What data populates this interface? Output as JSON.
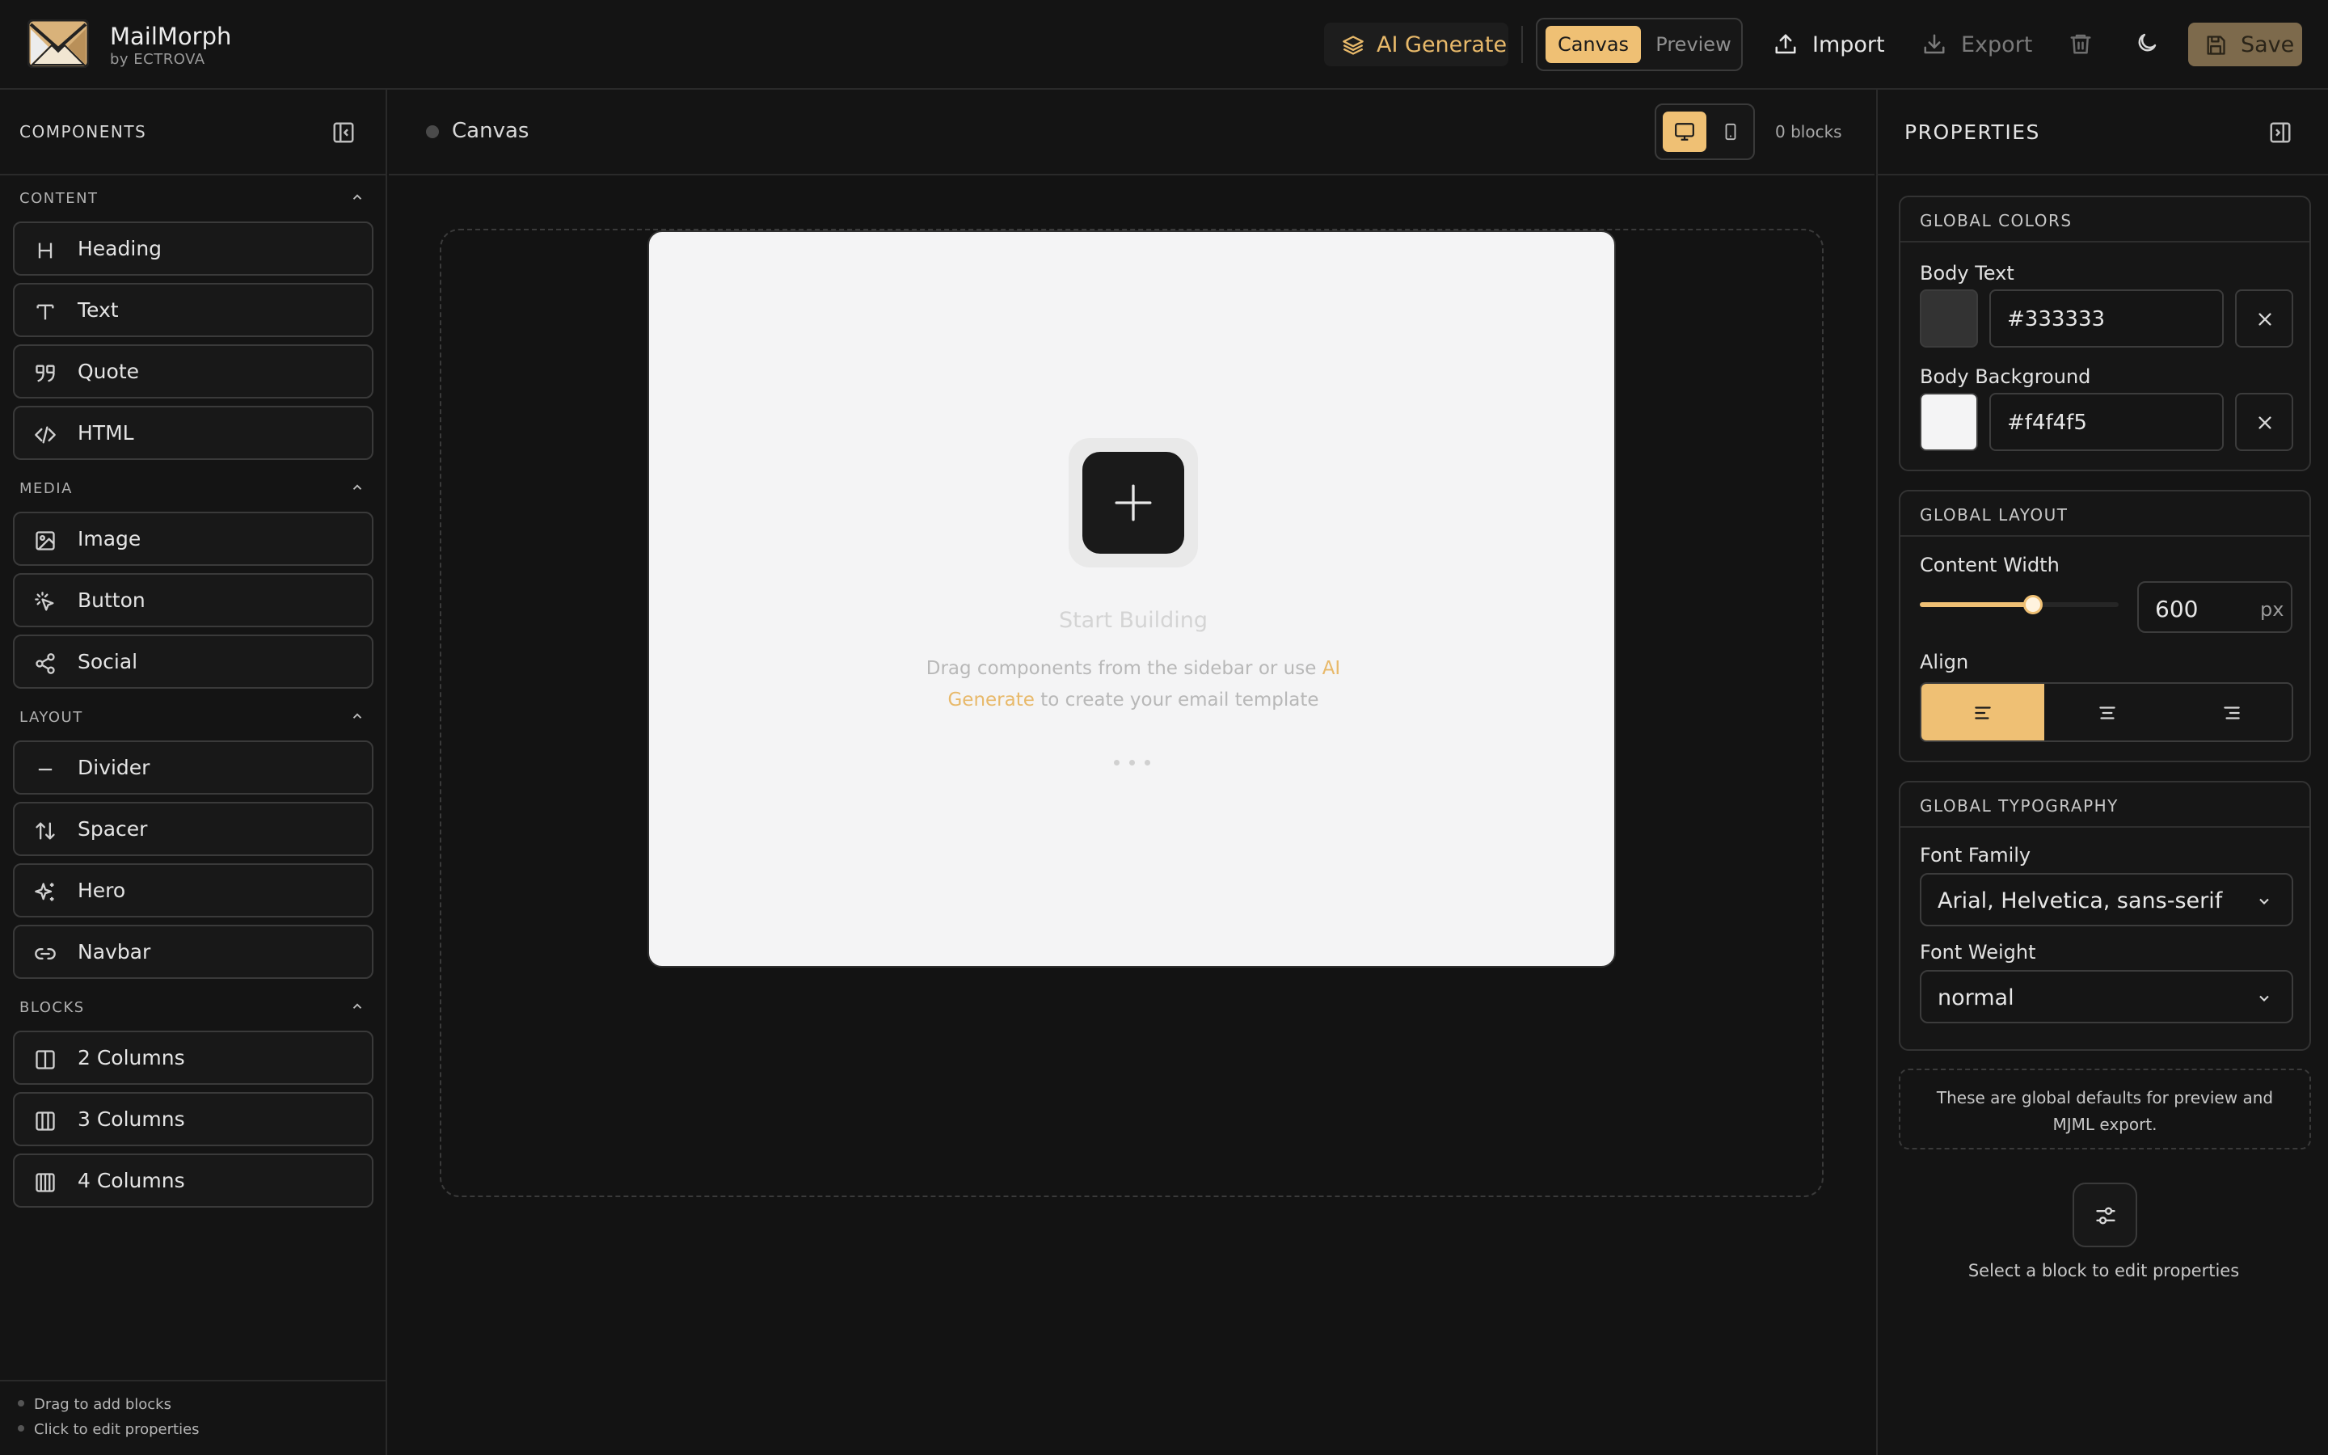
{
  "app": {
    "name": "MailMorph",
    "by_line": "by ECTROVA"
  },
  "toolbar": {
    "ai_generate": "AI Generate",
    "view_tabs": [
      "Canvas",
      "Preview"
    ],
    "active_view": "Canvas",
    "import": "Import",
    "export": "Export",
    "save": "Save"
  },
  "sidebar": {
    "title": "COMPONENTS",
    "sections": [
      {
        "label": "CONTENT",
        "items": [
          {
            "label": "Heading",
            "icon": "heading-icon"
          },
          {
            "label": "Text",
            "icon": "text-icon"
          },
          {
            "label": "Quote",
            "icon": "quote-icon"
          },
          {
            "label": "HTML",
            "icon": "code-icon"
          }
        ]
      },
      {
        "label": "MEDIA",
        "items": [
          {
            "label": "Image",
            "icon": "image-icon"
          },
          {
            "label": "Button",
            "icon": "pointer-click-icon"
          },
          {
            "label": "Social",
            "icon": "share-icon"
          }
        ]
      },
      {
        "label": "LAYOUT",
        "items": [
          {
            "label": "Divider",
            "icon": "minus-icon"
          },
          {
            "label": "Spacer",
            "icon": "arrows-updown-icon"
          },
          {
            "label": "Hero",
            "icon": "sparkles-icon"
          },
          {
            "label": "Navbar",
            "icon": "link-icon"
          }
        ]
      },
      {
        "label": "BLOCKS",
        "items": [
          {
            "label": "2 Columns",
            "icon": "columns-2-icon"
          },
          {
            "label": "3 Columns",
            "icon": "columns-3-icon"
          },
          {
            "label": "4 Columns",
            "icon": "columns-4-icon"
          }
        ]
      }
    ],
    "hints": [
      "Drag to add blocks",
      "Click to edit properties"
    ]
  },
  "canvas": {
    "title": "Canvas",
    "blocks_count": "0 blocks",
    "device": "desktop",
    "empty_title": "Start Building",
    "empty_text_before": "Drag components from the sidebar or use ",
    "empty_text_link": "AI Generate",
    "empty_text_after": " to create your email template"
  },
  "properties": {
    "title": "PROPERTIES",
    "global_colors": {
      "heading": "GLOBAL COLORS",
      "body_text_label": "Body Text",
      "body_text_value": "#333333",
      "body_bg_label": "Body Background",
      "body_bg_value": "#f4f4f5"
    },
    "global_layout": {
      "heading": "GLOBAL LAYOUT",
      "content_width_label": "Content Width",
      "content_width_value": "600",
      "content_width_unit": "px",
      "content_width_slider_fraction": 0.57,
      "align_label": "Align",
      "align_options": [
        "left",
        "center",
        "right"
      ],
      "align_value": "left"
    },
    "global_typography": {
      "heading": "GLOBAL TYPOGRAPHY",
      "font_family_label": "Font Family",
      "font_family_value": "Arial, Helvetica, sans-serif",
      "font_weight_label": "Font Weight",
      "font_weight_value": "normal"
    },
    "note": "These are global defaults for preview and MJML export.",
    "empty_state": "Select a block to edit properties"
  },
  "colors": {
    "accent": "#efc074",
    "accent_text": "#e8b96a",
    "background": "#131313",
    "canvas": "#f4f4f5"
  }
}
